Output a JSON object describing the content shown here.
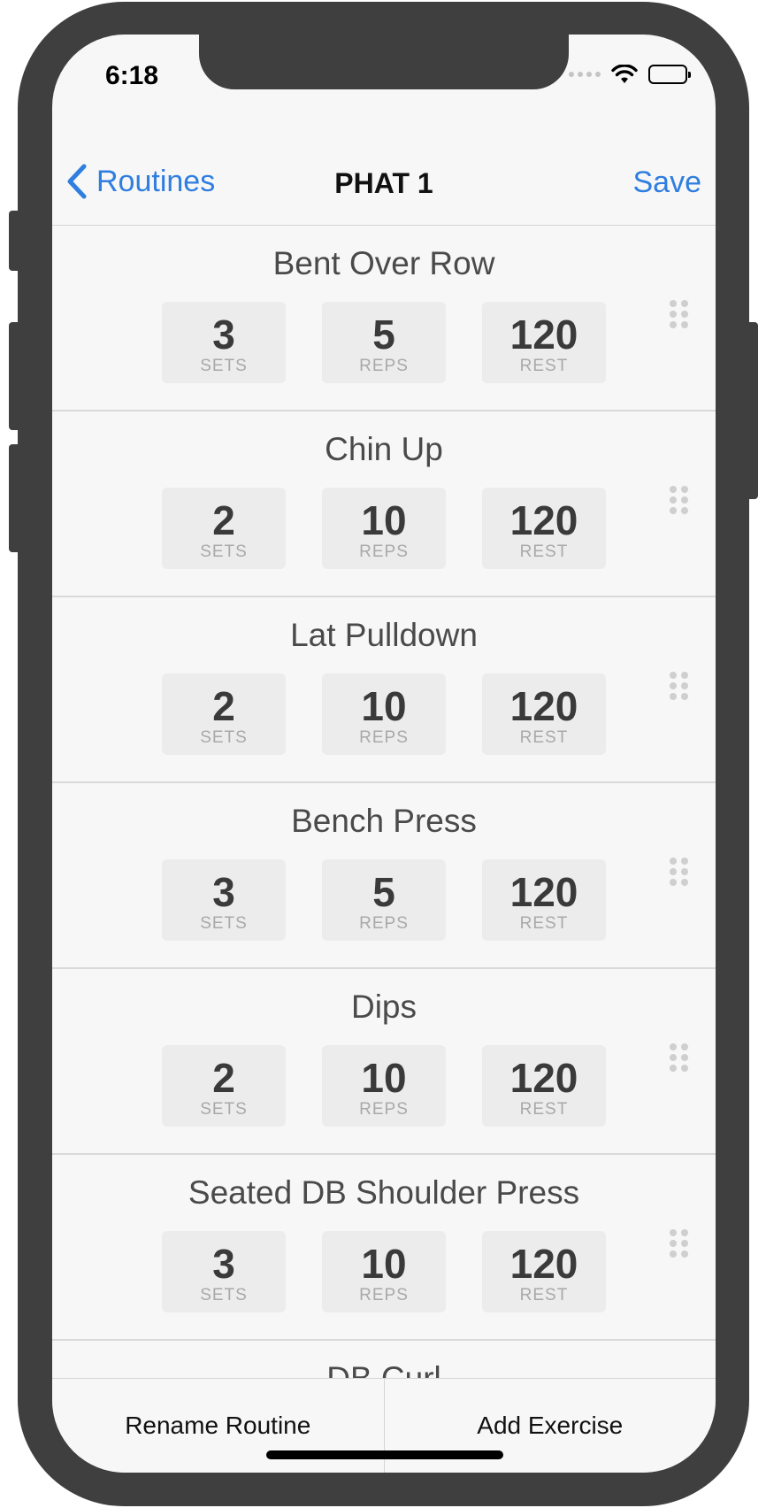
{
  "status_bar": {
    "time": "6:18"
  },
  "nav": {
    "back_label": "Routines",
    "title": "PHAT 1",
    "save_label": "Save"
  },
  "labels": {
    "sets": "SETS",
    "reps": "REPS",
    "rest": "REST"
  },
  "exercises": [
    {
      "name": "Bent Over Row",
      "sets": "3",
      "reps": "5",
      "rest": "120"
    },
    {
      "name": "Chin Up",
      "sets": "2",
      "reps": "10",
      "rest": "120"
    },
    {
      "name": "Lat Pulldown",
      "sets": "2",
      "reps": "10",
      "rest": "120"
    },
    {
      "name": "Bench Press",
      "sets": "3",
      "reps": "5",
      "rest": "120"
    },
    {
      "name": "Dips",
      "sets": "2",
      "reps": "10",
      "rest": "120"
    },
    {
      "name": "Seated DB Shoulder Press",
      "sets": "3",
      "reps": "10",
      "rest": "120"
    },
    {
      "name": "DB Curl"
    }
  ],
  "toolbar": {
    "rename_label": "Rename Routine",
    "add_label": "Add Exercise"
  },
  "colors": {
    "accent": "#2f7ee0",
    "device": "#3f3f3f",
    "background": "#f7f7f7"
  }
}
